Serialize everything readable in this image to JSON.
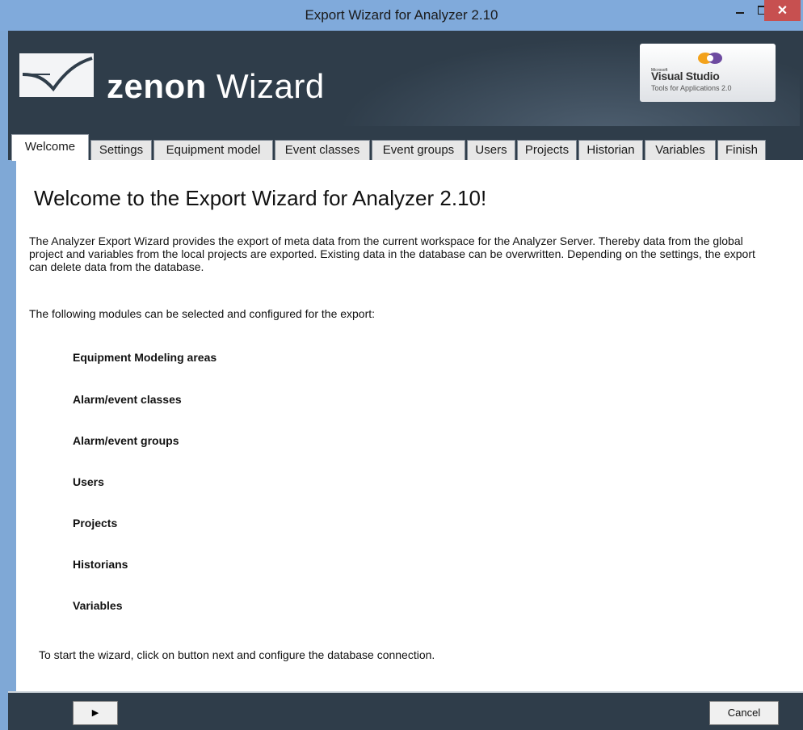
{
  "window": {
    "title": "Export Wizard for Analyzer 2.10"
  },
  "banner": {
    "brand_zenon": "zenon",
    "brand_wizard": "Wizard",
    "vs_small": "Microsoft",
    "vs_main": "Visual Studio",
    "vs_sub": "Tools for Applications 2.0"
  },
  "tabs": [
    {
      "label": "Welcome",
      "active": true
    },
    {
      "label": "Settings"
    },
    {
      "label": "Equipment model"
    },
    {
      "label": "Event classes"
    },
    {
      "label": "Event groups"
    },
    {
      "label": "Users"
    },
    {
      "label": "Projects"
    },
    {
      "label": "Historian"
    },
    {
      "label": "Variables"
    },
    {
      "label": "Finish"
    }
  ],
  "content": {
    "heading": "Welcome to the Export Wizard for Analyzer 2.10!",
    "paragraph": "The Analyzer Export Wizard provides the export of meta data from the current workspace for the Analyzer Server. Thereby data from the global project and variables from the local projects are exported. Existing data in the database can be overwritten. Depending on the settings, the export can delete data from the database.",
    "lead": "The following modules can be selected and configured for the export:",
    "modules": [
      "Equipment Modeling areas",
      "Alarm/event classes",
      "Alarm/event groups",
      "Users",
      "Projects",
      "Historians",
      "Variables"
    ],
    "footer_note": "To start the wizard, click on button next and configure the database connection."
  },
  "footer": {
    "next_symbol": "▶",
    "cancel_label": "Cancel"
  },
  "colors": {
    "titlebar": "#80aadb",
    "banner": "#2f3d4a",
    "close": "#c75050"
  }
}
